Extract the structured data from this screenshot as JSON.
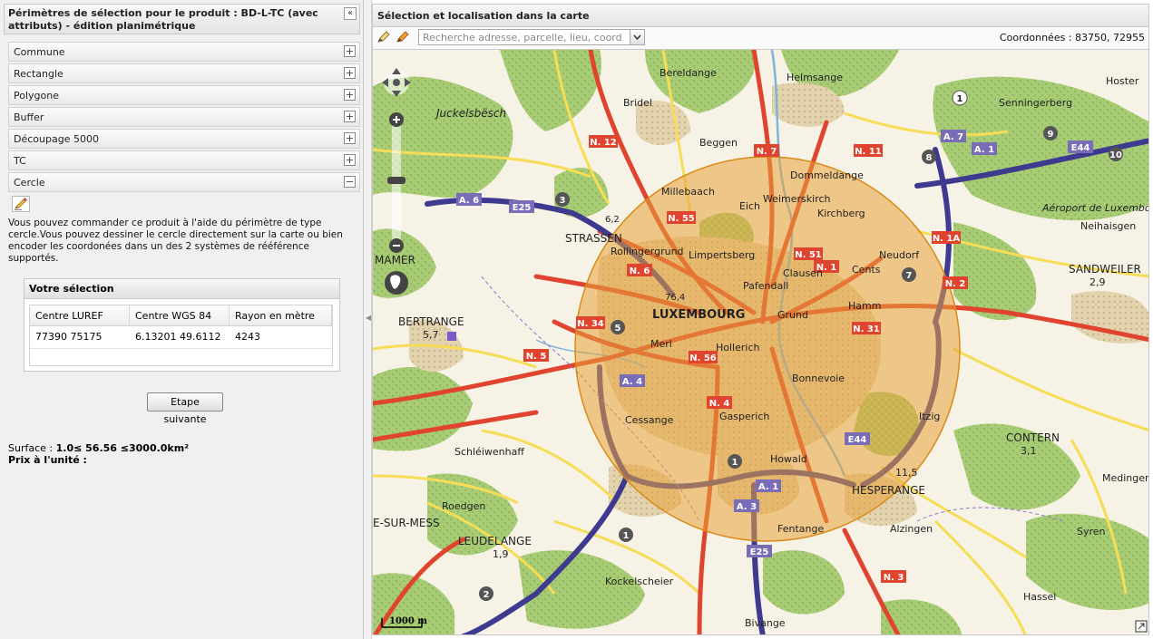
{
  "left_panel": {
    "title": "Périmètres de sélection pour le produit : BD-L-TC (avec attributs) - édition planimétrique",
    "collapse_label": "«",
    "accordion": [
      {
        "label": "Commune",
        "state": "+"
      },
      {
        "label": "Rectangle",
        "state": "+"
      },
      {
        "label": "Polygone",
        "state": "+"
      },
      {
        "label": "Buffer",
        "state": "+"
      },
      {
        "label": "Découpage 5000",
        "state": "+"
      },
      {
        "label": "TC",
        "state": "+"
      },
      {
        "label": "Cercle",
        "state": "−"
      }
    ],
    "description": "Vous pouvez commander ce produit à l'aide du périmètre de type cercle.Vous pouvez dessiner le cercle directement sur la carte ou bien encoder les coordonées dans un des 2 systèmes de rééférence supportés.",
    "selection": {
      "title": "Votre sélection",
      "columns": [
        "Centre LUREF",
        "Centre WGS 84",
        "Rayon en mètre"
      ],
      "rows": [
        [
          "77390 75175",
          "6.13201 49.6112",
          "4243"
        ]
      ]
    },
    "next_button": "Etape suivante",
    "surface_label": "Surface :",
    "surface_value": "1.0≤ 56.56 ≤3000.0km²",
    "price_label": "Prix à l'unité :"
  },
  "right_panel": {
    "title": "Sélection et localisation dans la carte",
    "search_placeholder": "Recherche adresse, parcelle, lieu, coordonnÃ(",
    "coordinates": "Coordonnées : 83750, 72955",
    "scale_label": "1000 m"
  },
  "map": {
    "labels": [
      {
        "text": "LUXEMBOURG",
        "size": 13,
        "bold": true
      },
      {
        "text": "STRASSEN",
        "size": 12,
        "bold": false
      },
      {
        "text": "BERTRANGE",
        "size": 12,
        "bold": false
      },
      {
        "text": "5,7",
        "size": 11,
        "bold": false
      },
      {
        "text": "SANDWEILER",
        "size": 12,
        "bold": false
      },
      {
        "text": "2,9",
        "size": 11,
        "bold": false
      },
      {
        "text": "CONTERN",
        "size": 12,
        "bold": false
      },
      {
        "text": "3,1",
        "size": 11,
        "bold": false
      },
      {
        "text": "HESPERANGE",
        "size": 12,
        "bold": false
      },
      {
        "text": "LEUDELANGE",
        "size": 12,
        "bold": false
      },
      {
        "text": "1,9",
        "size": 11,
        "bold": false
      },
      {
        "text": "E-SUR-MESS",
        "size": 12,
        "bold": false
      },
      {
        "text": "MAMER",
        "size": 12,
        "bold": false
      },
      {
        "text": "Bereldange",
        "size": 11,
        "bold": false
      },
      {
        "text": "Bridel",
        "size": 11,
        "bold": false
      },
      {
        "text": "Helmsange",
        "size": 11,
        "bold": false
      },
      {
        "text": "Beggen",
        "size": 11,
        "bold": false
      },
      {
        "text": "Dommeldange",
        "size": 11,
        "bold": false
      },
      {
        "text": "Weimerskirch",
        "size": 11,
        "bold": false
      },
      {
        "text": "Kirchberg",
        "size": 11,
        "bold": false
      },
      {
        "text": "Millebaach",
        "size": 11,
        "bold": false
      },
      {
        "text": "Eich",
        "size": 11,
        "bold": false
      },
      {
        "text": "Rollingergrund",
        "size": 11,
        "bold": false
      },
      {
        "text": "Limpertsberg",
        "size": 11,
        "bold": false
      },
      {
        "text": "Clausen",
        "size": 11,
        "bold": false
      },
      {
        "text": "Cents",
        "size": 11,
        "bold": false
      },
      {
        "text": "Neudorf",
        "size": 11,
        "bold": false
      },
      {
        "text": "Pafendall",
        "size": 11,
        "bold": false
      },
      {
        "text": "Grund",
        "size": 11,
        "bold": false
      },
      {
        "text": "Hamm",
        "size": 11,
        "bold": false
      },
      {
        "text": "Merl",
        "size": 11,
        "bold": false
      },
      {
        "text": "Hollerich",
        "size": 11,
        "bold": false
      },
      {
        "text": "Bonnevoie",
        "size": 11,
        "bold": false
      },
      {
        "text": "Cessange",
        "size": 11,
        "bold": false
      },
      {
        "text": "Gasperich",
        "size": 11,
        "bold": false
      },
      {
        "text": "Howald",
        "size": 11,
        "bold": false
      },
      {
        "text": "Itzig",
        "size": 11,
        "bold": false
      },
      {
        "text": "Fentange",
        "size": 11,
        "bold": false
      },
      {
        "text": "Alzingen",
        "size": 11,
        "bold": false
      },
      {
        "text": "Syren",
        "size": 11,
        "bold": false
      },
      {
        "text": "Hassel",
        "size": 11,
        "bold": false
      },
      {
        "text": "Medingen",
        "size": 11,
        "bold": false
      },
      {
        "text": "Roedgen",
        "size": 11,
        "bold": false
      },
      {
        "text": "Schléiwenhaff",
        "size": 11,
        "bold": false
      },
      {
        "text": "Kockelscheier",
        "size": 11,
        "bold": false
      },
      {
        "text": "Bivange",
        "size": 11,
        "bold": false
      },
      {
        "text": "Senningerberg",
        "size": 11,
        "bold": false
      },
      {
        "text": "Neihaisgen",
        "size": 11,
        "bold": false
      },
      {
        "text": "Aéroport de Luxembourg",
        "size": 11,
        "bold": false
      },
      {
        "text": "Juckelsbësch",
        "size": 12,
        "bold": false
      },
      {
        "text": "Hoster",
        "size": 11,
        "bold": false
      },
      {
        "text": "11,5",
        "size": 11,
        "bold": false
      },
      {
        "text": "76,4",
        "size": 10,
        "bold": false
      },
      {
        "text": "6,2",
        "size": 10,
        "bold": false
      }
    ],
    "road_shields": [
      "A. 6",
      "E25",
      "A. 7",
      "A. 1",
      "E44",
      "N. 6",
      "N. 55",
      "N. 51",
      "N. 1",
      "N. 2",
      "N. 34",
      "N. 5",
      "N. 56",
      "A. 4",
      "A. 3",
      "E25",
      "A. 1",
      "E44",
      "N. 3",
      "N. 12",
      "N. 7",
      "N. 11",
      "N. 1A",
      "N. 4",
      "N. 31"
    ],
    "colors": {
      "buffer_fill": "#e8a23a",
      "buffer_stroke": "#d98a16",
      "road_main": "#e0432e",
      "motorway": "#3e3a8f",
      "forest": "#9cc36a",
      "urban": "#d7c59a"
    }
  }
}
